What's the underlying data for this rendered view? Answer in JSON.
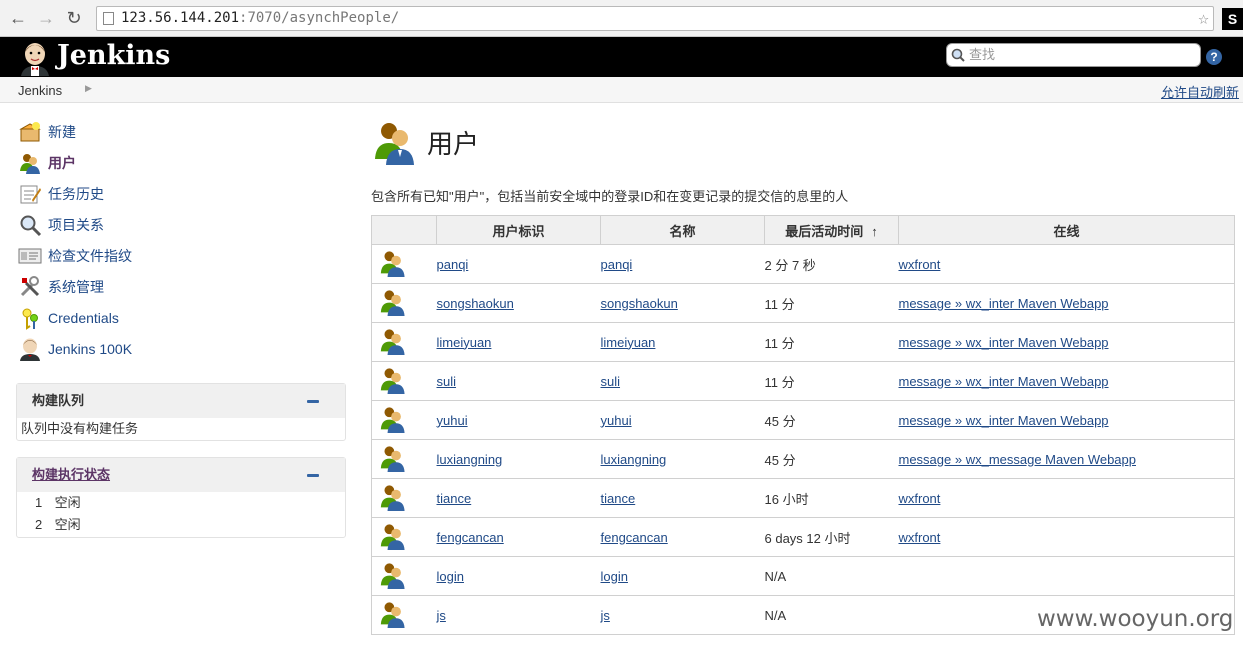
{
  "browser": {
    "url_host": "123.56.144.201",
    "url_port": ":7070",
    "url_path": "/asynchPeople/",
    "ext_label": "S"
  },
  "header": {
    "logo_text": "Jenkins",
    "search_placeholder": "查找",
    "help_label": "?"
  },
  "breadcrumb": {
    "root": "Jenkins",
    "refresh_label": "允许自动刷新"
  },
  "sidebar": {
    "items": [
      {
        "label": "新建"
      },
      {
        "label": "用户"
      },
      {
        "label": "任务历史"
      },
      {
        "label": "项目关系"
      },
      {
        "label": "检查文件指纹"
      },
      {
        "label": "系统管理"
      },
      {
        "label": "Credentials"
      },
      {
        "label": "Jenkins 100K"
      }
    ]
  },
  "build_queue": {
    "title": "构建队列",
    "empty_text": "队列中没有构建任务"
  },
  "executors": {
    "title": "构建执行状态",
    "rows": [
      {
        "num": "1",
        "status": "空闲"
      },
      {
        "num": "2",
        "status": "空闲"
      }
    ]
  },
  "main": {
    "title": "用户",
    "description": "包含所有已知\"用户\"，包括当前安全域中的登录ID和在变更记录的提交信的息里的人"
  },
  "table": {
    "headers": {
      "user_id": "用户标识",
      "name": "名称",
      "last_active": "最后活动时间",
      "sort_arrow": "↑",
      "online": "在线"
    },
    "rows": [
      {
        "user_id": "panqi",
        "name": "panqi",
        "last_active": "2 分 7 秒",
        "online": "wxfront"
      },
      {
        "user_id": "songshaokun",
        "name": "songshaokun",
        "last_active": "11 分",
        "online": "message » wx_inter Maven Webapp"
      },
      {
        "user_id": "limeiyuan",
        "name": "limeiyuan",
        "last_active": "11 分",
        "online": "message » wx_inter Maven Webapp"
      },
      {
        "user_id": "suli",
        "name": "suli",
        "last_active": "11 分",
        "online": "message » wx_inter Maven Webapp"
      },
      {
        "user_id": "yuhui",
        "name": "yuhui",
        "last_active": "45 分",
        "online": "message » wx_inter Maven Webapp"
      },
      {
        "user_id": "luxiangning",
        "name": "luxiangning",
        "last_active": "45 分",
        "online": "message » wx_message Maven Webapp"
      },
      {
        "user_id": "tiance",
        "name": "tiance",
        "last_active": "16 小时",
        "online": "wxfront"
      },
      {
        "user_id": "fengcancan",
        "name": "fengcancan",
        "last_active": "6 days 12 小时",
        "online": "wxfront"
      },
      {
        "user_id": "login",
        "name": "login",
        "last_active": "N/A",
        "online": ""
      },
      {
        "user_id": "js",
        "name": "js",
        "last_active": "N/A",
        "online": ""
      }
    ]
  },
  "watermark": "www.wooyun.org"
}
